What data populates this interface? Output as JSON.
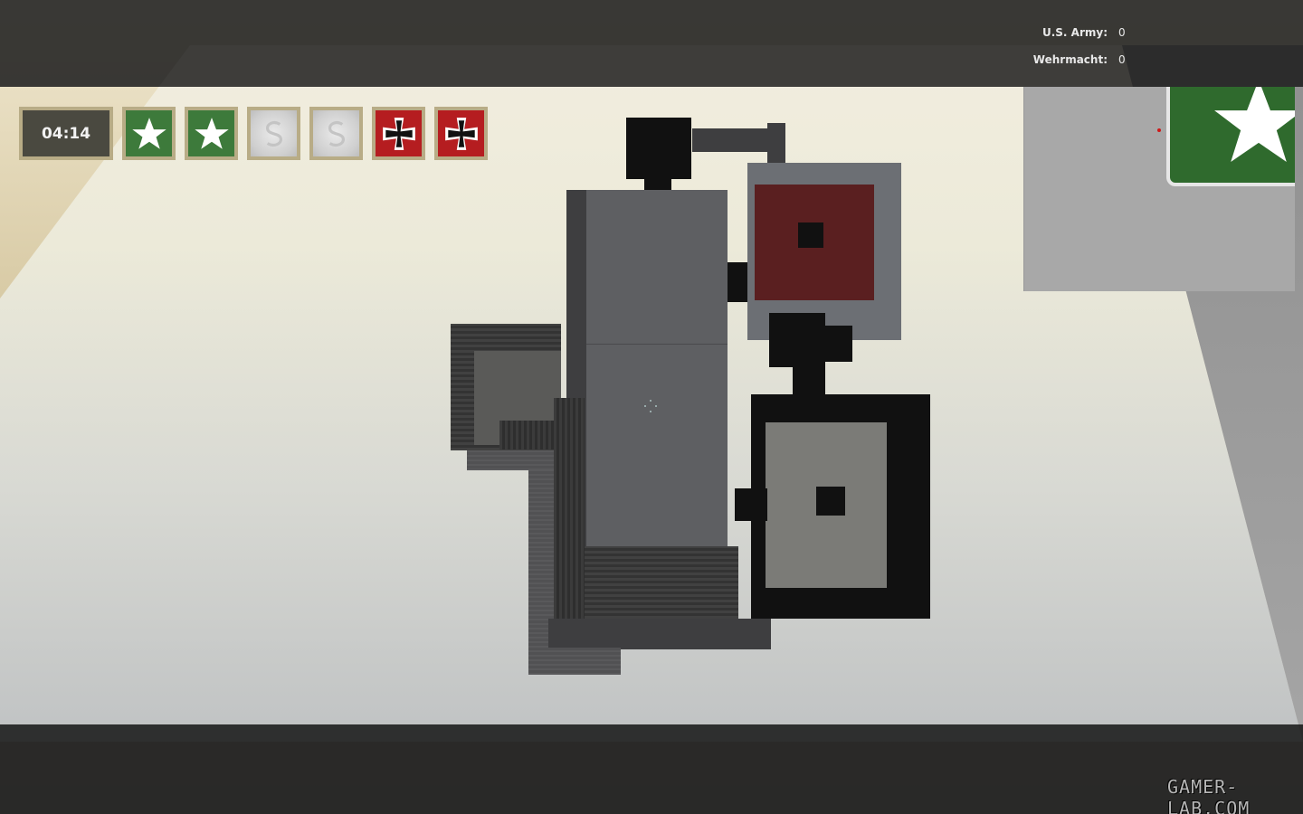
{
  "scoreboard": {
    "teams": [
      {
        "label": "U.S. Army:",
        "score": "0"
      },
      {
        "label": "Wehrmacht:",
        "score": "0"
      }
    ]
  },
  "hud": {
    "round_timer": "04:14",
    "capture_flags": [
      {
        "owner": "allies",
        "icon": "star-icon"
      },
      {
        "owner": "allies",
        "icon": "star-icon"
      },
      {
        "owner": "neutral",
        "icon": "neutral-flag-icon"
      },
      {
        "owner": "neutral",
        "icon": "neutral-flag-icon"
      },
      {
        "owner": "axis",
        "icon": "iron-cross-icon"
      },
      {
        "owner": "axis",
        "icon": "iron-cross-icon"
      }
    ],
    "colors": {
      "allies": "#3d7a3b",
      "axis": "#b51d20",
      "neutral": "#d8d8d8",
      "frame": "#b8ac86"
    }
  },
  "minimap": {
    "visible_flag_owner": "allies",
    "player_marker_color": "#d01818"
  },
  "watermark": "GAMER-LAB.COM"
}
